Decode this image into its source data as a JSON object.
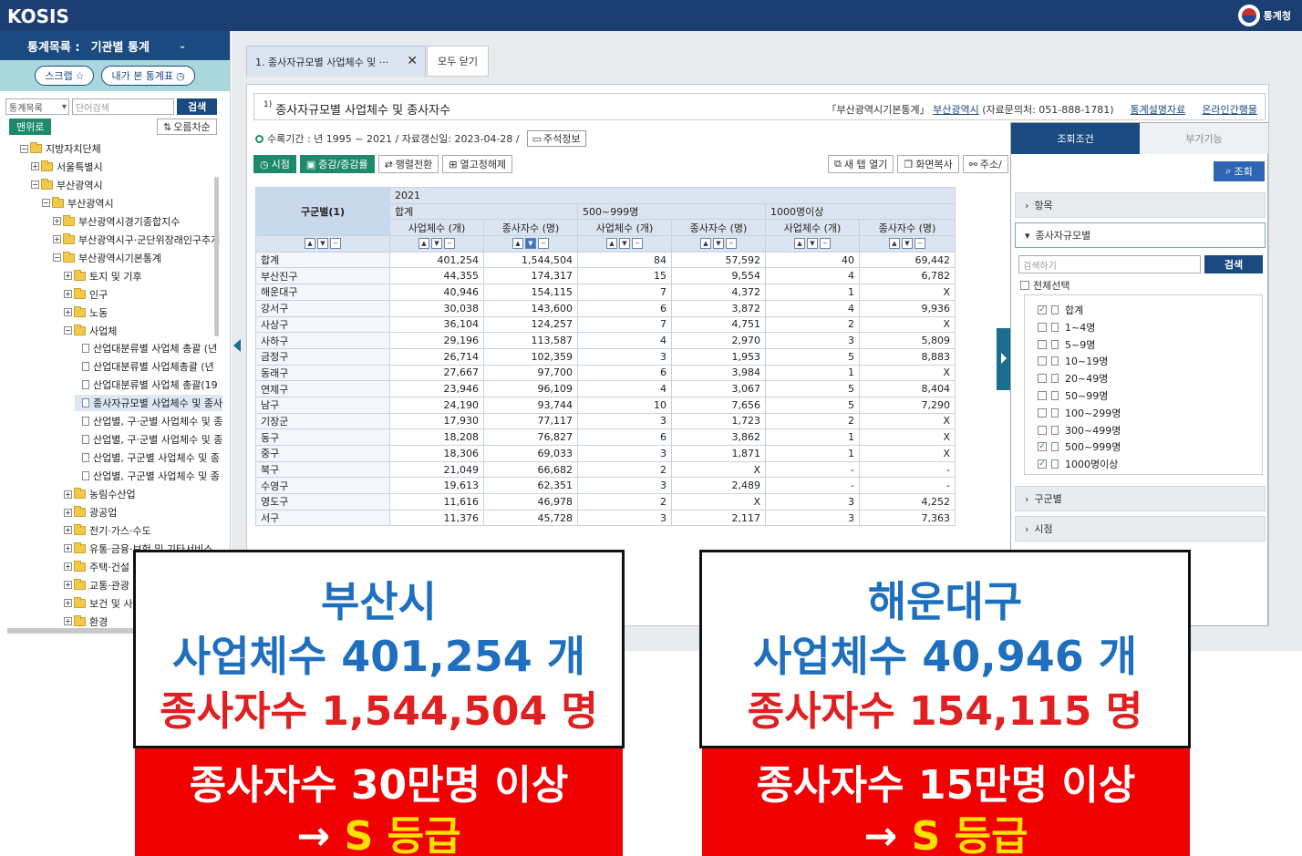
{
  "header": {
    "logo": "KOSIS",
    "agency": "통계청"
  },
  "sidebar": {
    "heading": "통계목록 :",
    "heading_value": "기관별 통계",
    "scrap_label": "스크랩",
    "recent_label": "내가 본 통계표",
    "list_select": "통계목록",
    "search_placeholder": "단어검색",
    "search_button": "검색",
    "up_button": "맨위로",
    "sort_button": "오름차순",
    "tree": [
      {
        "label": "지방자치단체",
        "pm": "−",
        "type": "folder",
        "indent": 0
      },
      {
        "label": "서울특별시",
        "pm": "+",
        "type": "folder",
        "indent": 1
      },
      {
        "label": "부산광역시",
        "pm": "−",
        "type": "folder",
        "indent": 1
      },
      {
        "label": "부산광역시",
        "pm": "−",
        "type": "folder",
        "indent": 2
      },
      {
        "label": "부산광역시경기종합지수",
        "pm": "+",
        "type": "folder",
        "indent": 3
      },
      {
        "label": "부산광역시구·군단위장래인구추계",
        "pm": "+",
        "type": "folder",
        "indent": 3
      },
      {
        "label": "부산광역시기본통계",
        "pm": "−",
        "type": "folder",
        "indent": 3
      },
      {
        "label": "토지 및 기후",
        "pm": "+",
        "type": "folder",
        "indent": 4
      },
      {
        "label": "인구",
        "pm": "+",
        "type": "folder",
        "indent": 4
      },
      {
        "label": "노동",
        "pm": "+",
        "type": "folder",
        "indent": 4
      },
      {
        "label": "사업체",
        "pm": "−",
        "type": "folder",
        "indent": 4
      },
      {
        "label": "산업대분류별 사업체 총괄 (년",
        "pm": "",
        "type": "doc",
        "indent": 5
      },
      {
        "label": "산업대분류별 사업체총괄 (년",
        "pm": "",
        "type": "doc",
        "indent": 5
      },
      {
        "label": "산업대분류별 사업체 총괄(19",
        "pm": "",
        "type": "doc",
        "indent": 5
      },
      {
        "label": "종사자규모별 사업체수 및 종사",
        "pm": "",
        "type": "doc",
        "indent": 5,
        "selected": true
      },
      {
        "label": "산업별, 구·군별 사업체수 및 종",
        "pm": "",
        "type": "doc",
        "indent": 5
      },
      {
        "label": "산업별, 구·군별 사업체수 및 종",
        "pm": "",
        "type": "doc",
        "indent": 5
      },
      {
        "label": "산업별, 구군별 사업체수 및 종",
        "pm": "",
        "type": "doc",
        "indent": 5
      },
      {
        "label": "산업별, 구군별 사업체수 및 종",
        "pm": "",
        "type": "doc",
        "indent": 5
      },
      {
        "label": "농림수산업",
        "pm": "+",
        "type": "folder",
        "indent": 4
      },
      {
        "label": "광공업",
        "pm": "+",
        "type": "folder",
        "indent": 4
      },
      {
        "label": "전기·가스·수도",
        "pm": "+",
        "type": "folder",
        "indent": 4
      },
      {
        "label": "유통·금융·보험 및 기타서비스",
        "pm": "+",
        "type": "folder",
        "indent": 4
      },
      {
        "label": "주택·건설",
        "pm": "+",
        "type": "folder",
        "indent": 4
      },
      {
        "label": "교통·관광",
        "pm": "+",
        "type": "folder",
        "indent": 4
      },
      {
        "label": "보건 및 사회보장",
        "pm": "+",
        "type": "folder",
        "indent": 4
      },
      {
        "label": "환경",
        "pm": "+",
        "type": "folder",
        "indent": 4
      }
    ]
  },
  "tabs": {
    "active": "1. 종사자규모별 사업체수 및 ···",
    "close_all": "모두 닫기"
  },
  "table_header": {
    "title": "종사자규모별 사업체수 및 종사자수",
    "footnote": "1)",
    "source": "「부산광역시기본통계」",
    "org": "부산광역시",
    "contact": "(자료문의처: 051-888-1781)",
    "desc_link": "통계설명자료",
    "online_link": "온라인간행물"
  },
  "meta": {
    "period": "수록기간 : 년 1995 ~ 2021 / 자료갱신일: 2023-04-28 /",
    "note_button": "주석정보"
  },
  "toolbar": {
    "time": "시점",
    "change": "증감/증감률",
    "transpose": "행렬전환",
    "unfreeze": "열고정해제",
    "new_window": "새 탭 열기",
    "copy": "화면복사",
    "address": "주소/"
  },
  "grid": {
    "corner": "구군별(1)",
    "year": "2021",
    "groups": [
      "합계",
      "500~999명",
      "1000명이상"
    ],
    "subheads": [
      "사업체수 (개)",
      "종사자수 (명)",
      "사업체수 (개)",
      "종사자수 (명)",
      "사업체수 (개)",
      "종사자수 (명)"
    ],
    "rows": [
      [
        "합계",
        "401,254",
        "1,544,504",
        "84",
        "57,592",
        "40",
        "69,442"
      ],
      [
        "부산진구",
        "44,355",
        "174,317",
        "15",
        "9,554",
        "4",
        "6,782"
      ],
      [
        "해운대구",
        "40,946",
        "154,115",
        "7",
        "4,372",
        "1",
        "X"
      ],
      [
        "강서구",
        "30,038",
        "143,600",
        "6",
        "3,872",
        "4",
        "9,936"
      ],
      [
        "사상구",
        "36,104",
        "124,257",
        "7",
        "4,751",
        "2",
        "X"
      ],
      [
        "사하구",
        "29,196",
        "113,587",
        "4",
        "2,970",
        "3",
        "5,809"
      ],
      [
        "금정구",
        "26,714",
        "102,359",
        "3",
        "1,953",
        "5",
        "8,883"
      ],
      [
        "동래구",
        "27,667",
        "97,700",
        "6",
        "3,984",
        "1",
        "X"
      ],
      [
        "연제구",
        "23,946",
        "96,109",
        "4",
        "3,067",
        "5",
        "8,404"
      ],
      [
        "남구",
        "24,190",
        "93,744",
        "10",
        "7,656",
        "5",
        "7,290"
      ],
      [
        "기장군",
        "17,930",
        "77,117",
        "3",
        "1,723",
        "2",
        "X"
      ],
      [
        "동구",
        "18,208",
        "76,827",
        "6",
        "3,862",
        "1",
        "X"
      ],
      [
        "중구",
        "18,306",
        "69,033",
        "3",
        "1,871",
        "1",
        "X"
      ],
      [
        "북구",
        "21,049",
        "66,682",
        "2",
        "X",
        "-",
        "-"
      ],
      [
        "수영구",
        "19,613",
        "62,351",
        "3",
        "2,489",
        "-",
        "-"
      ],
      [
        "영도구",
        "11,616",
        "46,978",
        "2",
        "X",
        "3",
        "4,252"
      ],
      [
        "서구",
        "11,376",
        "45,728",
        "3",
        "2,117",
        "3",
        "7,363"
      ]
    ]
  },
  "condition_panel": {
    "tab_condition": "조회조건",
    "tab_extra": "부가기능",
    "query_button": "조회",
    "item_section": "항목",
    "size_section": "종사자규모별",
    "search_placeholder": "검색하기",
    "search_button": "검색",
    "select_all": "전체선택",
    "options": [
      {
        "label": "합계",
        "checked": true
      },
      {
        "label": "1~4명",
        "checked": false
      },
      {
        "label": "5~9명",
        "checked": false
      },
      {
        "label": "10~19명",
        "checked": false
      },
      {
        "label": "20~49명",
        "checked": false
      },
      {
        "label": "50~99명",
        "checked": false
      },
      {
        "label": "100~299명",
        "checked": false
      },
      {
        "label": "300~499명",
        "checked": false
      },
      {
        "label": "500~999명",
        "checked": true
      },
      {
        "label": "1000명이상",
        "checked": true
      }
    ],
    "district_section": "구군별",
    "time_section": "시점"
  },
  "overlays": {
    "left": {
      "line1": "부산시",
      "line2": "사업체수 401,254 개",
      "line3": "종사자수 1,544,504 명",
      "red_line1": "종사자수 30만명 이상",
      "red_arrow": "→",
      "red_grade": "S 등급"
    },
    "right": {
      "line1": "해운대구",
      "line2": "사업체수 40,946 개",
      "line3": "종사자수 154,115 명",
      "red_line1": "종사자수 15만명 이상",
      "red_arrow": "→",
      "red_grade": "S 등급"
    }
  },
  "colors": {
    "nav": "#1c3f73",
    "accent_green": "#1f8a6b",
    "overlay_blue": "#1f6fbf",
    "overlay_red": "#f00000",
    "grade_yellow": "#ffe000"
  }
}
